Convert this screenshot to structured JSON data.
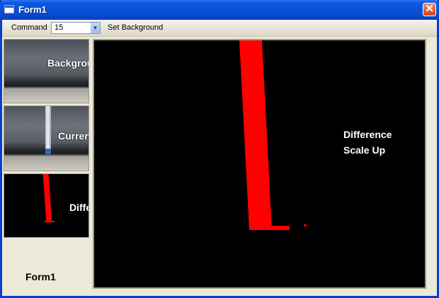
{
  "window": {
    "title": "Form1",
    "close_glyph": "✕",
    "icon": "form-app-icon"
  },
  "toolbar": {
    "command_label": "Command",
    "command_value": "15",
    "dropdown_glyph": "▼",
    "set_background_label": "Set Background"
  },
  "thumbnails": {
    "background_label": "Background",
    "current_label": "Current",
    "difference_label": "Difference"
  },
  "form_label": "Form1",
  "main_view": {
    "line1": "Difference",
    "line2": "Scale Up"
  },
  "colors": {
    "title_blue": "#0a4fd6",
    "accent_red": "#ff0000",
    "panel_bg": "#ece9d8"
  }
}
